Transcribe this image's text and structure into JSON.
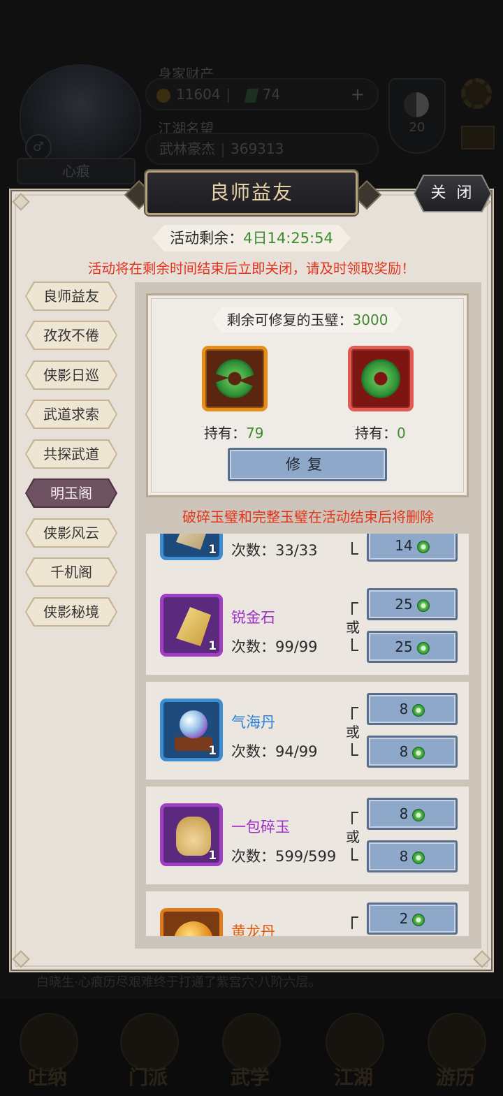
{
  "hud": {
    "wealth_label": "身家财产",
    "coins": "11604",
    "gems": "74",
    "plus": "+",
    "fame_label": "江湖名望",
    "fame_title": "武林豪杰",
    "fame_value": "369313",
    "portrait_tag": "心痕",
    "gender": "♂",
    "cultivation_level": "20",
    "log_line": "白晓生·心痕历尽艰难终于打通了紫宫穴·八阶六层。"
  },
  "bottom_nav": [
    {
      "label": "吐纳"
    },
    {
      "label": "门派"
    },
    {
      "label": "武学"
    },
    {
      "label": "江湖"
    },
    {
      "label": "游历"
    }
  ],
  "dialog": {
    "title": "良师益友",
    "close_label": "关 闭",
    "timer_label": "活动剩余：",
    "timer_value": "4日14:25:54",
    "warning": "活动将在剩余时间结束后立即关闭，请及时领取奖励！",
    "delete_warning": "破碎玉璧和完整玉璧在活动结束后将删除"
  },
  "side_tabs": [
    {
      "label": "良师益友",
      "active": false
    },
    {
      "label": "孜孜不倦",
      "active": false
    },
    {
      "label": "侠影日巡",
      "active": false
    },
    {
      "label": "武道求索",
      "active": false
    },
    {
      "label": "共探武道",
      "active": false
    },
    {
      "label": "明玉阁",
      "active": true
    },
    {
      "label": "侠影风云",
      "active": false
    },
    {
      "label": "千机阁",
      "active": false
    },
    {
      "label": "侠影秘境",
      "active": false
    }
  ],
  "repair": {
    "remain_label": "剩余可修复的玉璧：",
    "remain_value": "3000",
    "broken_hold_label": "持有：",
    "broken_hold_value": "79",
    "whole_hold_label": "持有：",
    "whole_hold_value": "0",
    "button_label": "修复",
    "broken_icon": "broken-jade-disc-icon",
    "whole_icon": "whole-jade-disc-icon"
  },
  "exchange": {
    "count_prefix": "次数：",
    "or_label": "或",
    "items": [
      {
        "name": "",
        "count": "33/33",
        "quantity": "1",
        "rarity": "blue",
        "costs": [
          "14"
        ]
      },
      {
        "name": "锐金石",
        "count": "99/99",
        "quantity": "1",
        "rarity": "purple",
        "costs": [
          "25",
          "25"
        ]
      },
      {
        "name": "气海丹",
        "count": "94/99",
        "quantity": "1",
        "rarity": "blue",
        "costs": [
          "8",
          "8"
        ]
      },
      {
        "name": "一包碎玉",
        "count": "599/599",
        "quantity": "1",
        "rarity": "purple",
        "costs": [
          "8",
          "8"
        ]
      },
      {
        "name": "黄龙丹",
        "count": "",
        "quantity": "",
        "rarity": "orange",
        "costs": [
          "2"
        ]
      }
    ]
  },
  "colors": {
    "accent_green": "#3f8a2c",
    "warning_red": "#e2341d",
    "active_tab": "#6f5262",
    "button_blue": "#8ea8c9"
  }
}
